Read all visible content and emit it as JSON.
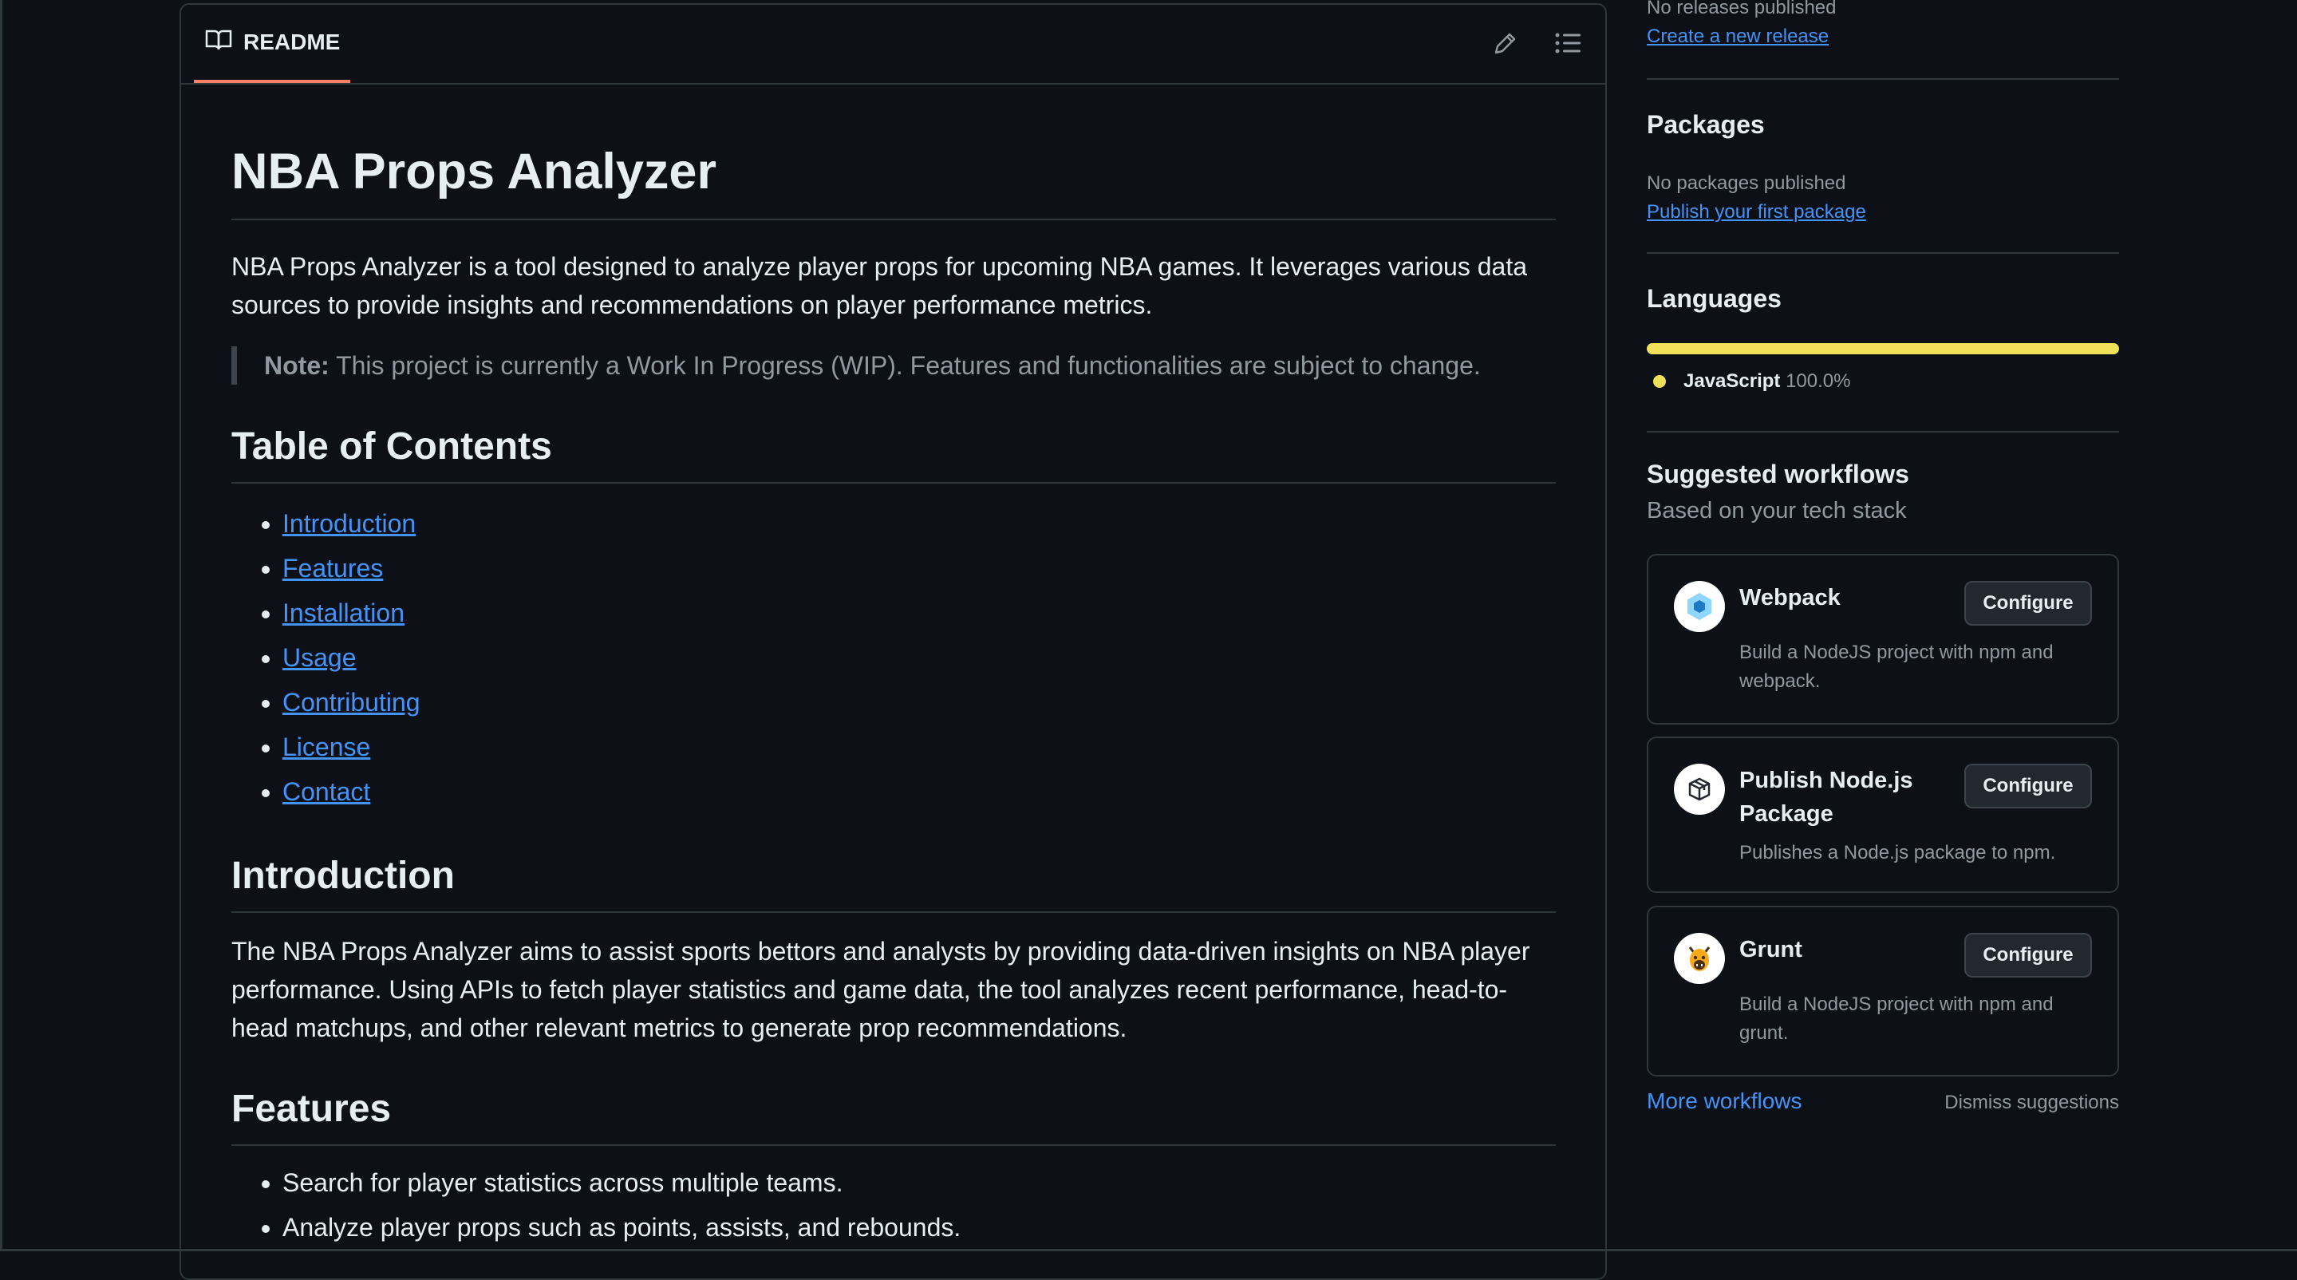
{
  "readme": {
    "tab_label": "README",
    "title": "NBA Props Analyzer",
    "intro_para": "NBA Props Analyzer is a tool designed to analyze player props for upcoming NBA games. It leverages various data sources to provide insights and recommendations on player performance metrics.",
    "note_label": "Note:",
    "note_text": " This project is currently a Work In Progress (WIP). Features and functionalities are subject to change.",
    "toc_heading": "Table of Contents",
    "toc": [
      "Introduction",
      "Features",
      "Installation",
      "Usage",
      "Contributing",
      "License",
      "Contact"
    ],
    "introduction_heading": "Introduction",
    "introduction_text": "The NBA Props Analyzer aims to assist sports bettors and analysts by providing data-driven insights on NBA player performance. Using APIs to fetch player statistics and game data, the tool analyzes recent performance, head-to-head matchups, and other relevant metrics to generate prop recommendations.",
    "features_heading": "Features",
    "features": [
      "Search for player statistics across multiple teams.",
      "Analyze player props such as points, assists, and rebounds."
    ]
  },
  "sidebar": {
    "releases": {
      "empty_text": "No releases published",
      "create_link": "Create a new release"
    },
    "packages": {
      "heading": "Packages",
      "empty_text": "No packages published",
      "publish_link": "Publish your first package"
    },
    "languages": {
      "heading": "Languages",
      "items": [
        {
          "name": "JavaScript",
          "percent": "100.0%",
          "share": 100,
          "color": "#f1e05a"
        }
      ]
    },
    "workflows": {
      "heading": "Suggested workflows",
      "subheading": "Based on your tech stack",
      "items": [
        {
          "name": "Webpack",
          "description": "Build a NodeJS project with npm and webpack.",
          "button": "Configure",
          "icon": "webpack-icon"
        },
        {
          "name": "Publish Node.js Package",
          "description": "Publishes a Node.js package to npm.",
          "button": "Configure",
          "icon": "package-icon"
        },
        {
          "name": "Grunt",
          "description": "Build a NodeJS project with npm and grunt.",
          "button": "Configure",
          "icon": "grunt-icon"
        }
      ],
      "more_link": "More workflows",
      "dismiss": "Dismiss suggestions"
    }
  },
  "colors": {
    "background": "#0d1117",
    "border": "#30363d",
    "link": "#4493f8",
    "tab_underline": "#f78166",
    "javascript": "#f1e05a"
  }
}
